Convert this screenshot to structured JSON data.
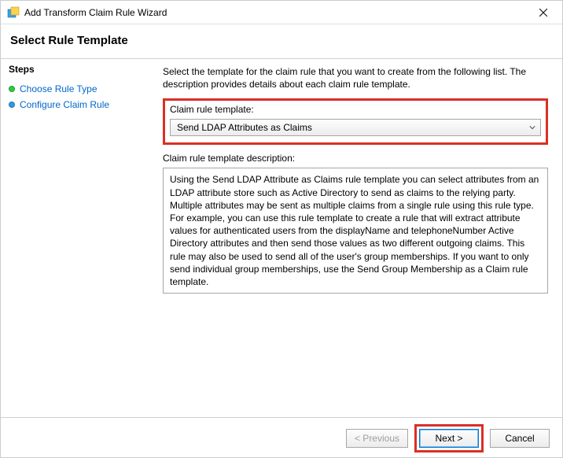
{
  "titlebar": {
    "title": "Add Transform Claim Rule Wizard"
  },
  "heading": "Select Rule Template",
  "sidebar": {
    "title": "Steps",
    "items": [
      {
        "label": "Choose Rule Type"
      },
      {
        "label": "Configure Claim Rule"
      }
    ]
  },
  "main": {
    "intro": "Select the template for the claim rule that you want to create from the following list. The description provides details about each claim rule template.",
    "template_label": "Claim rule template:",
    "template_value": "Send LDAP Attributes as Claims",
    "desc_label": "Claim rule template description:",
    "desc_text": "Using the Send LDAP Attribute as Claims rule template you can select attributes from an LDAP attribute store such as Active Directory to send as claims to the relying party. Multiple attributes may be sent as multiple claims from a single rule using this rule type. For example, you can use this rule template to create a rule that will extract attribute values for authenticated users from the displayName and telephoneNumber Active Directory attributes and then send those values as two different outgoing claims. This rule may also be used to send all of the user's group memberships. If you want to only send individual group memberships, use the Send Group Membership as a Claim rule template."
  },
  "footer": {
    "previous": "< Previous",
    "next": "Next >",
    "cancel": "Cancel"
  }
}
